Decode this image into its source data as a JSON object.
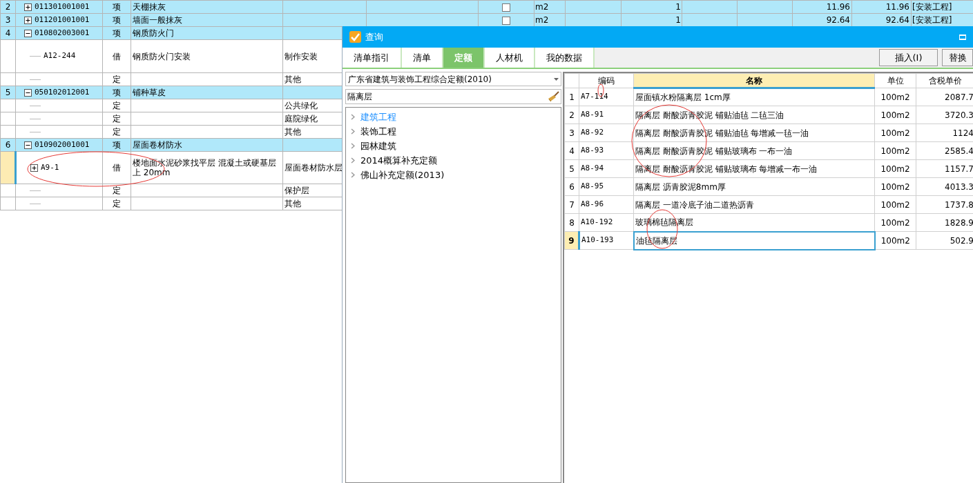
{
  "background_table": {
    "rows": [
      {
        "number": "2",
        "kind": "item",
        "expanded": false,
        "code": "011301001001",
        "type": "项",
        "name": "天棚抹灰",
        "feature": "",
        "selected": false,
        "checked": false,
        "unit": "m2",
        "quantity": "1",
        "price": "11.96",
        "total": "11.96",
        "category": "[安装工程]"
      },
      {
        "number": "3",
        "kind": "item",
        "expanded": false,
        "code": "011201001001",
        "type": "项",
        "name": "墙面一般抹灰",
        "feature": "",
        "selected": false,
        "checked": false,
        "unit": "m2",
        "quantity": "1",
        "price": "92.64",
        "total": "92.64",
        "category": "[安装工程]"
      },
      {
        "number": "4",
        "kind": "item",
        "expanded": true,
        "code": "010802003001",
        "type": "项",
        "name": "钢质防火门",
        "feature": "",
        "selected": false
      },
      {
        "number": "",
        "kind": "sub",
        "code": "A12-244",
        "type": "借",
        "name": "钢质防火门安装",
        "feature": "制作安装",
        "selected": false
      },
      {
        "number": "",
        "kind": "sub",
        "code": "",
        "type": "定",
        "name": "",
        "feature": "其他",
        "selected": false
      },
      {
        "number": "5",
        "kind": "item",
        "expanded": true,
        "code": "050102012001",
        "type": "项",
        "name": "铺种草皮",
        "feature": "",
        "selected": false
      },
      {
        "number": "",
        "kind": "sub",
        "code": "",
        "type": "定",
        "name": "",
        "feature": "公共绿化",
        "selected": false
      },
      {
        "number": "",
        "kind": "sub",
        "code": "",
        "type": "定",
        "name": "",
        "feature": "庭院绿化",
        "selected": false
      },
      {
        "number": "",
        "kind": "sub",
        "code": "",
        "type": "定",
        "name": "",
        "feature": "其他",
        "selected": false
      },
      {
        "number": "6",
        "kind": "item",
        "expanded": true,
        "code": "010902001001",
        "type": "项",
        "name": "屋面卷材防水",
        "feature": "",
        "selected": false
      },
      {
        "number": "",
        "kind": "sub",
        "expanded": false,
        "code": "A9-1",
        "type": "借",
        "name": "楼地面水泥砂浆找平层 混凝土或硬基层上 20mm",
        "feature": "屋面卷材防水层",
        "selected": true
      },
      {
        "number": "",
        "kind": "sub",
        "code": "",
        "type": "定",
        "name": "",
        "feature": "保护层",
        "selected": false
      },
      {
        "number": "",
        "kind": "sub",
        "code": "",
        "type": "定",
        "name": "",
        "feature": "其他",
        "selected": false
      }
    ]
  },
  "dialog": {
    "title": "查询",
    "tabs": [
      {
        "label": "清单指引",
        "selected": false
      },
      {
        "label": "清单",
        "selected": false
      },
      {
        "label": "定额",
        "selected": true
      },
      {
        "label": "人材机",
        "selected": false
      },
      {
        "label": "我的数据",
        "selected": false
      }
    ],
    "buttons": [
      "插入(I)",
      "替换"
    ],
    "library": "广东省建筑与装饰工程综合定额(2010)",
    "search": "隔离层",
    "tree": [
      {
        "label": "建筑工程",
        "selected": true
      },
      {
        "label": "装饰工程",
        "selected": false
      },
      {
        "label": "园林建筑",
        "selected": false
      },
      {
        "label": "2014概算补充定额",
        "selected": false
      },
      {
        "label": "佛山补充定额(2013)",
        "selected": false
      }
    ],
    "results": {
      "columns": [
        {
          "label": "编码",
          "selected": false
        },
        {
          "label": "名称",
          "selected": true
        },
        {
          "label": "单位",
          "selected": false
        },
        {
          "label": "含税单价",
          "selected": false
        }
      ],
      "rows": [
        {
          "number": "1",
          "code": "A7-114",
          "name": "屋面镇水粉隔离层 1cm厚",
          "unit": "100m2",
          "price": "2087.7",
          "selected": false
        },
        {
          "number": "2",
          "code": "A8-91",
          "name": "隔离层 耐酸沥青胶泥 铺贴油毡 二毡三油",
          "unit": "100m2",
          "price": "3720.3",
          "selected": false
        },
        {
          "number": "3",
          "code": "A8-92",
          "name": "隔离层 耐酸沥青胶泥 铺贴油毡 每增减一毡一油",
          "unit": "100m2",
          "price": "1124",
          "selected": false
        },
        {
          "number": "4",
          "code": "A8-93",
          "name": "隔离层 耐酸沥青胶泥 铺贴玻璃布 一布一油",
          "unit": "100m2",
          "price": "2585.4",
          "selected": false
        },
        {
          "number": "5",
          "code": "A8-94",
          "name": "隔离层 耐酸沥青胶泥 铺贴玻璃布 每增减一布一油",
          "unit": "100m2",
          "price": "1157.7",
          "selected": false
        },
        {
          "number": "6",
          "code": "A8-95",
          "name": "隔离层 沥青胶泥8mm厚",
          "unit": "100m2",
          "price": "4013.3",
          "selected": false
        },
        {
          "number": "7",
          "code": "A8-96",
          "name": "隔离层 一道冷底子油二道热沥青",
          "unit": "100m2",
          "price": "1737.8",
          "selected": false
        },
        {
          "number": "8",
          "code": "A10-192",
          "name": "玻璃棉毡隔离层",
          "unit": "100m2",
          "price": "1828.9",
          "selected": false
        },
        {
          "number": "9",
          "code": "A10-193",
          "name": "油毡隔离层",
          "unit": "100m2",
          "price": "502.9",
          "selected": true
        }
      ]
    }
  }
}
